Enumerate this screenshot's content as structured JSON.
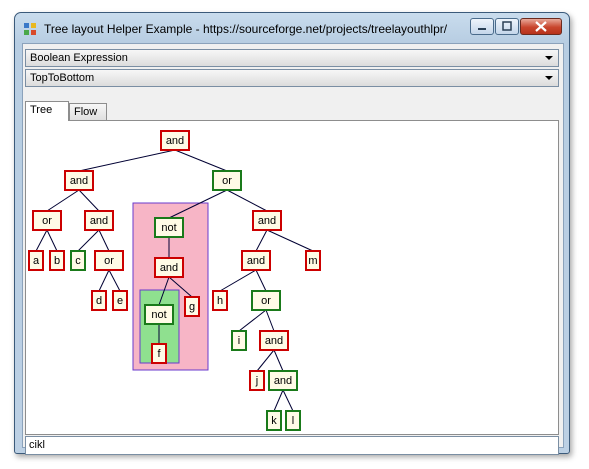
{
  "window": {
    "title": "Tree layout Helper Example - https://sourceforge.net/projects/treelayouthlpr/"
  },
  "combos": {
    "tree_type": "Boolean Expression",
    "direction": "TopToBottom"
  },
  "tabs": [
    {
      "label": "Tree",
      "active": true
    },
    {
      "label": "Flow",
      "active": false
    }
  ],
  "status": {
    "text": "cikl"
  },
  "colors": {
    "red_node": "#cc0000",
    "green_node": "#1a7a1a",
    "node_fill": "#fffbe6",
    "pink_group": "#f7b5c6",
    "green_group": "#8fe08f",
    "group_border": "#6a3acc"
  },
  "tree": {
    "nodes": [
      {
        "id": "n1",
        "label": "and",
        "color": "red"
      },
      {
        "id": "n2",
        "label": "and",
        "color": "red"
      },
      {
        "id": "n3",
        "label": "or",
        "color": "green"
      },
      {
        "id": "n4",
        "label": "or",
        "color": "red"
      },
      {
        "id": "n5",
        "label": "and",
        "color": "red"
      },
      {
        "id": "n6",
        "label": "a",
        "color": "red"
      },
      {
        "id": "n7",
        "label": "b",
        "color": "red"
      },
      {
        "id": "n8",
        "label": "c",
        "color": "green"
      },
      {
        "id": "n9",
        "label": "or",
        "color": "red"
      },
      {
        "id": "n10",
        "label": "d",
        "color": "red"
      },
      {
        "id": "n11",
        "label": "e",
        "color": "red"
      },
      {
        "id": "n12",
        "label": "not",
        "color": "green"
      },
      {
        "id": "n13",
        "label": "and",
        "color": "red"
      },
      {
        "id": "n14",
        "label": "not",
        "color": "green"
      },
      {
        "id": "n15",
        "label": "f",
        "color": "red"
      },
      {
        "id": "n16",
        "label": "g",
        "color": "red"
      },
      {
        "id": "n17",
        "label": "and",
        "color": "red"
      },
      {
        "id": "n18",
        "label": "and",
        "color": "red"
      },
      {
        "id": "n19",
        "label": "m",
        "color": "red"
      },
      {
        "id": "n20",
        "label": "h",
        "color": "red"
      },
      {
        "id": "n21",
        "label": "or",
        "color": "green"
      },
      {
        "id": "n22",
        "label": "i",
        "color": "green"
      },
      {
        "id": "n23",
        "label": "and",
        "color": "red"
      },
      {
        "id": "n24",
        "label": "j",
        "color": "red"
      },
      {
        "id": "n25",
        "label": "and",
        "color": "green"
      },
      {
        "id": "n26",
        "label": "k",
        "color": "green"
      },
      {
        "id": "n27",
        "label": "l",
        "color": "green"
      }
    ],
    "edges": [
      [
        "n1",
        "n2"
      ],
      [
        "n1",
        "n3"
      ],
      [
        "n2",
        "n4"
      ],
      [
        "n2",
        "n5"
      ],
      [
        "n4",
        "n6"
      ],
      [
        "n4",
        "n7"
      ],
      [
        "n5",
        "n8"
      ],
      [
        "n5",
        "n9"
      ],
      [
        "n9",
        "n10"
      ],
      [
        "n9",
        "n11"
      ],
      [
        "n3",
        "n12"
      ],
      [
        "n3",
        "n17"
      ],
      [
        "n12",
        "n13"
      ],
      [
        "n13",
        "n14"
      ],
      [
        "n13",
        "n16"
      ],
      [
        "n14",
        "n15"
      ],
      [
        "n17",
        "n18"
      ],
      [
        "n17",
        "n19"
      ],
      [
        "n18",
        "n20"
      ],
      [
        "n18",
        "n21"
      ],
      [
        "n21",
        "n22"
      ],
      [
        "n21",
        "n23"
      ],
      [
        "n23",
        "n24"
      ],
      [
        "n23",
        "n25"
      ],
      [
        "n25",
        "n26"
      ],
      [
        "n25",
        "n27"
      ]
    ]
  }
}
